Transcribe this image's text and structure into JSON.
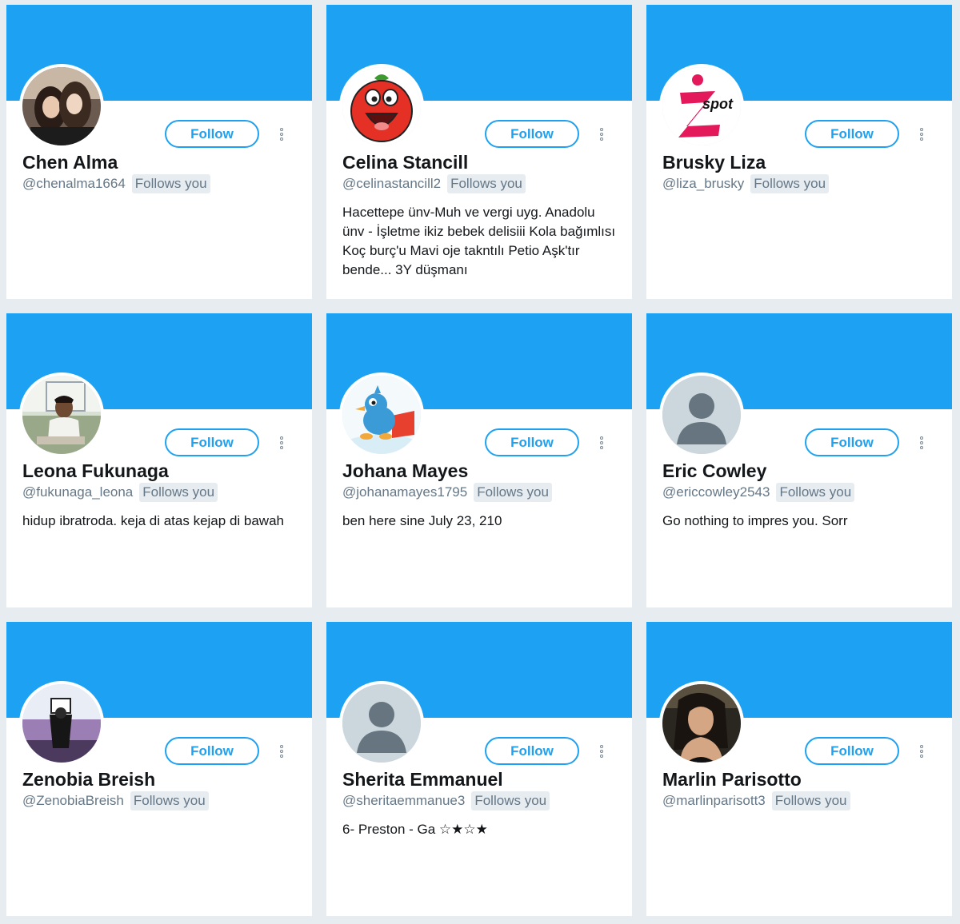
{
  "follow_label": "Follow",
  "follows_you_label": "Follows you",
  "colors": {
    "accent": "#1da1f2",
    "page_bg": "#e6ecf0"
  },
  "cards": [
    {
      "name": "Chen Alma",
      "handle": "@chenalma1664",
      "bio": "",
      "avatar": "photo-two-women"
    },
    {
      "name": "Celina Stancill",
      "handle": "@celinastancill2",
      "bio": "Hacettepe ünv-Muh ve vergi uyg. Anadolu ünv - İşletme ikiz bebek delisiii Kola bağımlısı Koç burç'u Mavi oje takntılı Petio Aşk'tır bende... 3Y düşmanı",
      "avatar": "cartoon-tomato"
    },
    {
      "name": "Brusky Liza",
      "handle": "@liza_brusky",
      "bio": "",
      "avatar": "logo-i-spot"
    },
    {
      "name": "Leona Fukunaga",
      "handle": "@fukunaga_leona",
      "bio": "hidup ibratroda. keja di atas kejap di bawah",
      "avatar": "photo-man-outdoors"
    },
    {
      "name": "Johana Mayes",
      "handle": "@johanamayes1795",
      "bio": "ben here sine July 23, 210",
      "avatar": "cartoon-bird-laptop"
    },
    {
      "name": "Eric Cowley",
      "handle": "@ericcowley2543",
      "bio": "Go nothing to impres you. Sorr",
      "avatar": "default-person"
    },
    {
      "name": "Zenobia Breish",
      "handle": "@ZenobiaBreish",
      "bio": "",
      "avatar": "photo-person-field"
    },
    {
      "name": "Sherita Emmanuel",
      "handle": "@sheritaemmanue3",
      "bio": "6- Preston - Ga ☆★☆★",
      "avatar": "default-person"
    },
    {
      "name": "Marlin Parisotto",
      "handle": "@marlinparisott3",
      "bio": "",
      "avatar": "photo-woman-portrait"
    }
  ]
}
